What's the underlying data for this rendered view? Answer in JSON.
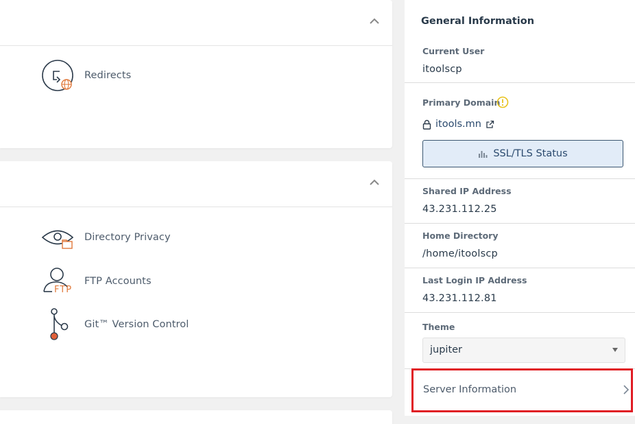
{
  "panels": {
    "files": {
      "tools": [
        {
          "label": "Redirects",
          "icon": "redirects-icon"
        }
      ]
    },
    "security": {
      "tools": [
        {
          "label": "Directory Privacy",
          "icon": "directory-privacy-icon"
        },
        {
          "label": "FTP Accounts",
          "icon": "ftp-accounts-icon",
          "icon_text": "FTP"
        },
        {
          "label": "Git™ Version Control",
          "icon": "git-icon"
        }
      ]
    }
  },
  "sidebar": {
    "title": "General Information",
    "current_user": {
      "label": "Current User",
      "value": "itoolscp"
    },
    "primary_domain": {
      "label": "Primary Domain",
      "value": "itools.mn",
      "ssl_button": "SSL/TLS Status"
    },
    "shared_ip": {
      "label": "Shared IP Address",
      "value": "43.231.112.25"
    },
    "home_directory": {
      "label": "Home Directory",
      "value": "/home/itoolscp"
    },
    "last_login_ip": {
      "label": "Last Login IP Address",
      "value": "43.231.112.81"
    },
    "theme": {
      "label": "Theme",
      "value": "jupiter"
    },
    "server_information": {
      "label": "Server Information"
    }
  },
  "colors": {
    "accent_orange": "#e0783a",
    "highlight_red": "#e01c24",
    "warning_yellow": "#e8c21c",
    "link_blue": "#2b4a6e"
  }
}
